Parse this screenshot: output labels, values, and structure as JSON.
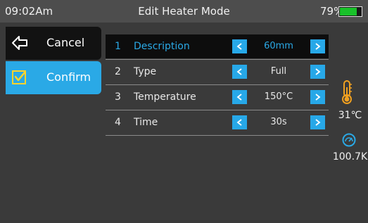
{
  "status_bar": {
    "time": "09:02Am",
    "title": "Edit Heater Mode",
    "battery_percent": "79%",
    "battery_level": 0.79
  },
  "buttons": {
    "cancel_label": "Cancel",
    "confirm_label": "Confirm"
  },
  "params": [
    {
      "num": "1",
      "name": "Description",
      "value": "60mm"
    },
    {
      "num": "2",
      "name": "Type",
      "value": "Full"
    },
    {
      "num": "3",
      "name": "Temperature",
      "value": "150°C"
    },
    {
      "num": "4",
      "name": "Time",
      "value": "30s"
    }
  ],
  "readouts": {
    "temperature": "31℃",
    "pressure": "100.7K"
  },
  "icons": {
    "cancel": "back-arrow-icon",
    "confirm": "checkbox-check-icon",
    "prev": "chevron-left-icon",
    "next": "chevron-right-icon",
    "temperature": "thermometer-icon",
    "pressure": "gauge-icon"
  },
  "colors": {
    "accent": "#2aa9e6",
    "background": "#3a3a3a",
    "status_bar": "#4d4d4d",
    "active_row": "#0d0d0d",
    "cancel_button": "#121212",
    "battery": "#19c22a"
  }
}
